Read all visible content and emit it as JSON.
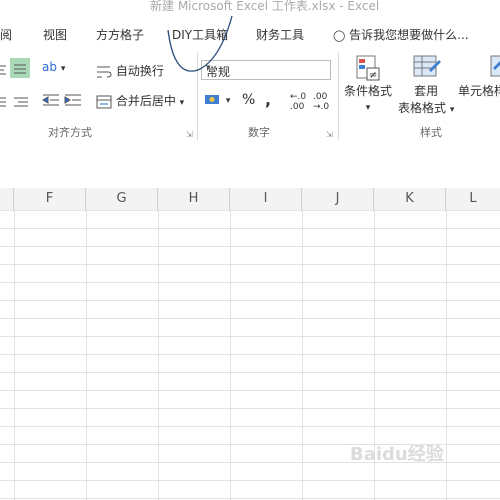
{
  "window": {
    "title": "新建 Microsoft Excel 工作表.xlsx - Excel"
  },
  "tabs": [
    {
      "label": "审阅"
    },
    {
      "label": "视图"
    },
    {
      "label": "方方格子"
    },
    {
      "label": "DIY工具箱"
    },
    {
      "label": "财务工具"
    }
  ],
  "tell_me": {
    "placeholder": "告诉我您想要做什么..."
  },
  "alignment": {
    "wrap_text": "自动换行",
    "merge_center": "合并后居中",
    "group_label": "对齐方式"
  },
  "number": {
    "format_value": "常规",
    "percent": "%",
    "comma": ",",
    "group_label": "数字"
  },
  "styles": {
    "conditional_format": "条件格式",
    "format_as_table_1": "套用",
    "format_as_table_2": "表格格式",
    "cell_styles": "单元格样式",
    "group_label": "样式"
  },
  "columns": [
    "F",
    "G",
    "H",
    "I",
    "J",
    "K",
    "L"
  ],
  "watermark": "Baidu经验",
  "colors": {
    "accent": "#217346",
    "grid": "#e2e2e2",
    "header_bg": "#f3f3f3"
  }
}
